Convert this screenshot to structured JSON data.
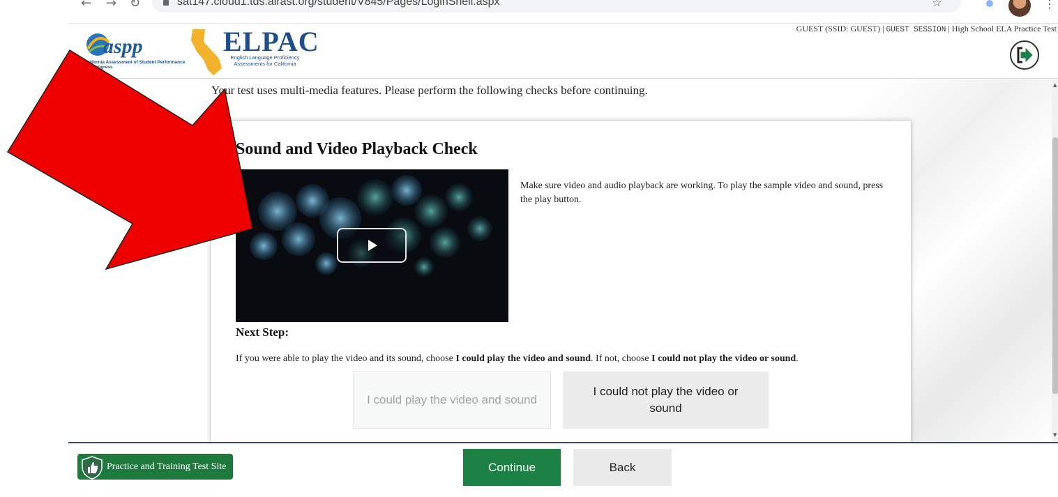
{
  "browser": {
    "url": "sat147.cloud1.tds.airast.org/student/V845/Pages/LoginShell.aspx",
    "back_icon": "arrow-left-icon",
    "forward_icon": "arrow-right-icon",
    "reload_icon": "reload-icon",
    "bookmark_icon": "star-icon",
    "menu_icon": "kebab-menu-icon"
  },
  "header": {
    "caaspp_logo_text": "caaspp",
    "caaspp_caption": "California Assessment of Student Performance and Progress",
    "elpac_title": "ELPAC",
    "elpac_subtitle": "English Language Proficiency Assessments for California",
    "session_user": "GUEST (SSID: GUEST)",
    "session_sep1": "|",
    "session_name": "GUEST SESSION",
    "session_sep2": "|",
    "test_name": "High School ELA Practice Test",
    "logout_icon": "logout-icon"
  },
  "main": {
    "intro": "Your test uses multi-media features. Please perform the following checks before continuing.",
    "card": {
      "title": "Sound and Video Playback Check",
      "description": "Make sure video and audio playback are working. To play the sample video and sound, press the play button.",
      "next_step_heading": "Next Step:",
      "instruction_prefix": "If you were able to play the video and its sound, choose ",
      "instruction_bold1": "I could play the video and sound",
      "instruction_mid": ". If not, choose ",
      "instruction_bold2": "I could not play the video or sound",
      "instruction_suffix": ".",
      "choice_could": "I could play the video and sound",
      "choice_could_not": "I could not play the video or sound"
    }
  },
  "footer": {
    "site_badge": "Practice and Training Test Site",
    "continue_label": "Continue",
    "back_label": "Back"
  },
  "colors": {
    "accent_green": "#1d8145",
    "badge_green": "#1e7a3c",
    "elpac_blue": "#1f4e8c",
    "annotation_red": "#ee0000"
  }
}
